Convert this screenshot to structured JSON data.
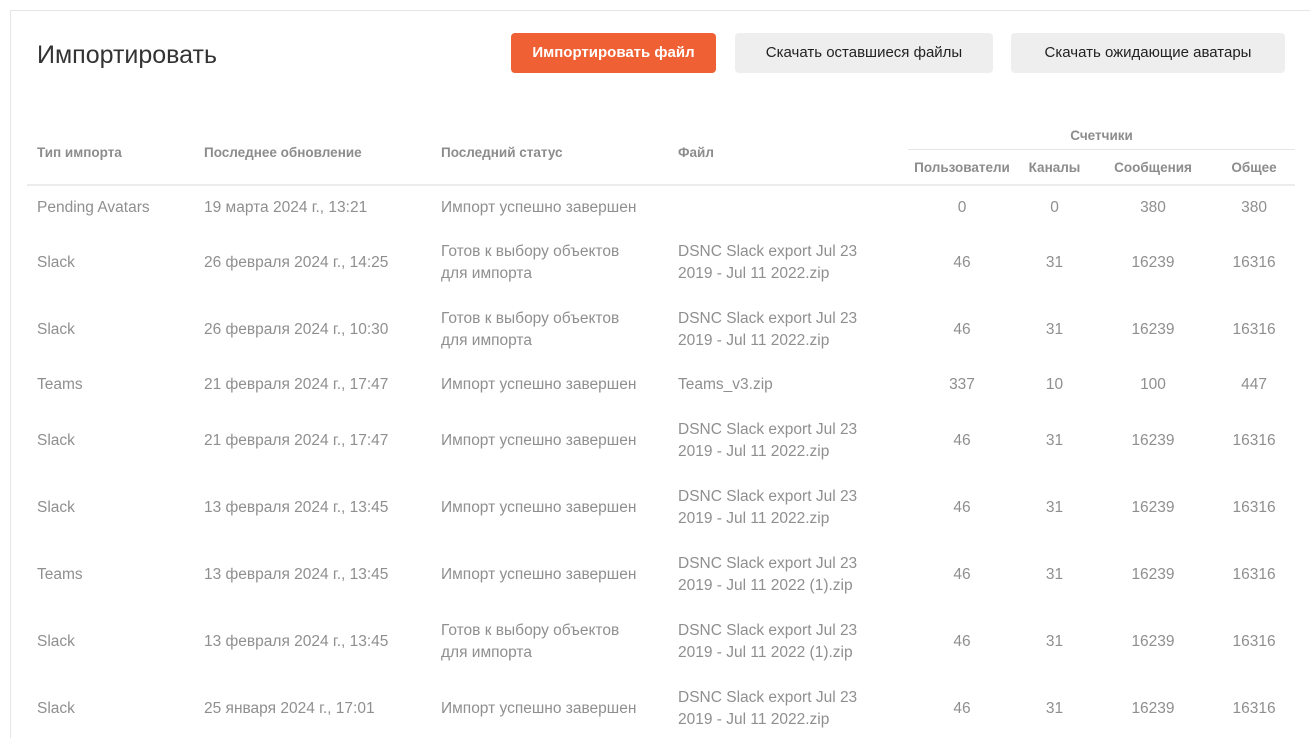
{
  "header": {
    "title": "Импортировать",
    "import_file_label": "Импортировать файл",
    "download_remaining_label": "Скачать оставшиеся файлы",
    "download_avatars_label": "Скачать ожидающие аватары"
  },
  "colors": {
    "primary_button": "#ef6034",
    "secondary_button": "#eeeeee"
  },
  "table": {
    "columns": {
      "type": "Тип импорта",
      "updated": "Последнее обновление",
      "status": "Последний статус",
      "file": "Файл",
      "counters_group": "Счетчики",
      "users": "Пользователи",
      "channels": "Каналы",
      "messages": "Сообщения",
      "total": "Общее"
    },
    "rows": [
      {
        "type": "Pending Avatars",
        "updated": "19 марта 2024 г., 13:21",
        "status_1": "Импорт успешно завершен",
        "status_2": "",
        "file_1": "",
        "file_2": "",
        "users": "0",
        "channels": "0",
        "messages": "380",
        "total": "380"
      },
      {
        "type": "Slack",
        "updated": "26 февраля 2024 г., 14:25",
        "status_1": "Готов к выбору объектов",
        "status_2": "для импорта",
        "file_1": "DSNC Slack export Jul 23",
        "file_2": "2019 - Jul 11 2022.zip",
        "users": "46",
        "channels": "31",
        "messages": "16239",
        "total": "16316"
      },
      {
        "type": "Slack",
        "updated": "26 февраля 2024 г., 10:30",
        "status_1": "Готов к выбору объектов",
        "status_2": "для импорта",
        "file_1": "DSNC Slack export Jul 23",
        "file_2": "2019 - Jul 11 2022.zip",
        "users": "46",
        "channels": "31",
        "messages": "16239",
        "total": "16316"
      },
      {
        "type": "Teams",
        "updated": "21 февраля 2024 г., 17:47",
        "status_1": "Импорт успешно завершен",
        "status_2": "",
        "file_1": "Teams_v3.zip",
        "file_2": "",
        "users": "337",
        "channels": "10",
        "messages": "100",
        "total": "447"
      },
      {
        "type": "Slack",
        "updated": "21 февраля 2024 г., 17:47",
        "status_1": "Импорт успешно завершен",
        "status_2": "",
        "file_1": "DSNC Slack export Jul 23",
        "file_2": "2019 - Jul 11 2022.zip",
        "users": "46",
        "channels": "31",
        "messages": "16239",
        "total": "16316"
      },
      {
        "type": "Slack",
        "updated": "13 февраля 2024 г., 13:45",
        "status_1": "Импорт успешно завершен",
        "status_2": "",
        "file_1": "DSNC Slack export Jul 23",
        "file_2": "2019 - Jul 11 2022.zip",
        "users": "46",
        "channels": "31",
        "messages": "16239",
        "total": "16316"
      },
      {
        "type": "Teams",
        "updated": "13 февраля 2024 г., 13:45",
        "status_1": "Импорт успешно завершен",
        "status_2": "",
        "file_1": "DSNC Slack export Jul 23",
        "file_2": "2019 - Jul 11 2022 (1).zip",
        "users": "46",
        "channels": "31",
        "messages": "16239",
        "total": "16316"
      },
      {
        "type": "Slack",
        "updated": "13 февраля 2024 г., 13:45",
        "status_1": "Готов к выбору объектов",
        "status_2": "для импорта",
        "file_1": "DSNC Slack export Jul 23",
        "file_2": "2019 - Jul 11 2022 (1).zip",
        "users": "46",
        "channels": "31",
        "messages": "16239",
        "total": "16316"
      },
      {
        "type": "Slack",
        "updated": "25 января 2024 г., 17:01",
        "status_1": "Импорт успешно завершен",
        "status_2": "",
        "file_1": "DSNC Slack export Jul 23",
        "file_2": "2019 - Jul 11 2022.zip",
        "users": "46",
        "channels": "31",
        "messages": "16239",
        "total": "16316"
      }
    ]
  }
}
